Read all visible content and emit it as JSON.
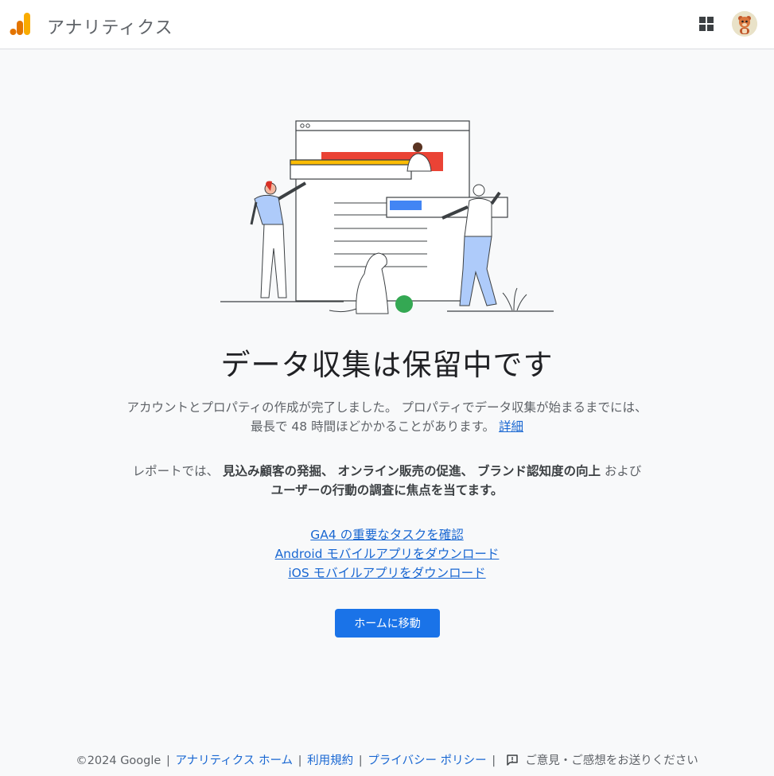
{
  "header": {
    "app_title": "アナリティクス",
    "apps_icon": "apps-grid-icon",
    "avatar_icon": "user-avatar-icon"
  },
  "main": {
    "heading": "データ収集は保留中です",
    "para1": {
      "line1": "アカウントとプロパティの作成が完了しました。 プロパティでデータ収集が始まるまでには、",
      "line2": "最長で 48 時間ほどかかることがあります。",
      "link": "詳細"
    },
    "para2": {
      "prefix": "レポートでは、",
      "b1": "見込み顧客の発掘、",
      "b2": "オンライン販売の促進、",
      "b3": "ブランド認知度の向上",
      "middle": "および",
      "b4": "ユーザーの行動の調査に焦点を当てます。"
    },
    "links": [
      "GA4 の重要なタスクを確認",
      "Android モバイルアプリをダウンロード",
      "iOS モバイルアプリをダウンロード"
    ],
    "home_button": "ホームに移動"
  },
  "footer": {
    "copyright": "©2024 Google",
    "links": [
      "アナリティクス ホーム",
      "利用規約",
      "プライバシー ポリシー"
    ],
    "feedback_icon": "feedback-icon",
    "feedback": "ご意見・ご感想をお送りください"
  },
  "colors": {
    "accent": "#1a73e8",
    "link": "#1967d2",
    "logo_orange": "#f9ab00",
    "logo_dark_orange": "#e37400"
  }
}
